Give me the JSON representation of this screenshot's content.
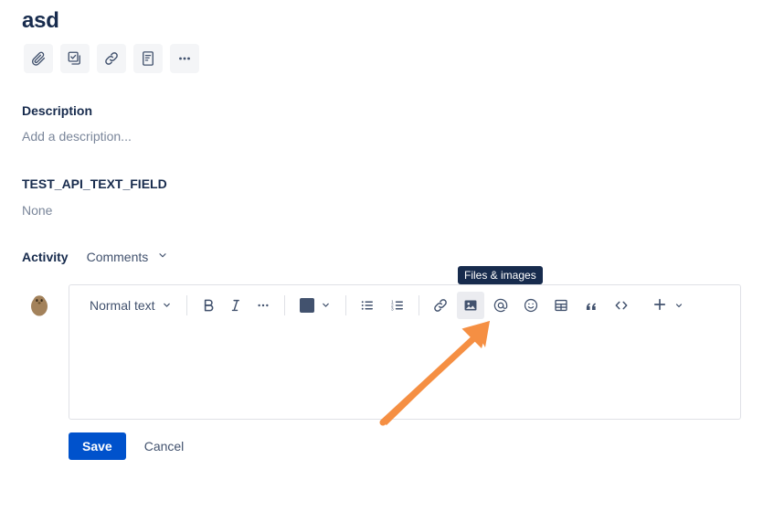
{
  "page": {
    "title": "asd"
  },
  "quick_actions": [
    {
      "name": "attach-icon",
      "label": "Attach"
    },
    {
      "name": "add-child-issue-icon",
      "label": "Add a child issue"
    },
    {
      "name": "link-issue-icon",
      "label": "Link issue"
    },
    {
      "name": "create-page-icon",
      "label": "Create Confluence page"
    },
    {
      "name": "more-actions-icon",
      "label": "More"
    }
  ],
  "fields": {
    "description": {
      "label": "Description",
      "placeholder": "Add a description..."
    },
    "custom_text": {
      "label": "TEST_API_TEXT_FIELD",
      "value": "None"
    }
  },
  "activity": {
    "title": "Activity",
    "filter_label": "Comments",
    "chevron": "chevron-down-icon"
  },
  "editor": {
    "text_style": "Normal text",
    "toolbar": [
      {
        "name": "text-style-dropdown",
        "label": "Normal text"
      },
      {
        "name": "bold-button",
        "label": "B"
      },
      {
        "name": "italic-button",
        "label": "I"
      },
      {
        "name": "more-formatting-button",
        "label": "..."
      },
      {
        "name": "text-color-button",
        "label": "Text color"
      },
      {
        "name": "bullet-list-button",
        "label": "Bullet list"
      },
      {
        "name": "numbered-list-button",
        "label": "Numbered list"
      },
      {
        "name": "link-button",
        "label": "Link"
      },
      {
        "name": "files-images-button",
        "label": "Files & images"
      },
      {
        "name": "mention-button",
        "label": "Mention"
      },
      {
        "name": "emoji-button",
        "label": "Emoji"
      },
      {
        "name": "table-button",
        "label": "Table"
      },
      {
        "name": "quote-button",
        "label": "Quote"
      },
      {
        "name": "code-snippet-button",
        "label": "Code snippet"
      },
      {
        "name": "insert-more-button",
        "label": "Insert more"
      }
    ],
    "content": "",
    "active_button": "files-images-button"
  },
  "tooltip": {
    "text": "Files & images"
  },
  "footer": {
    "save_label": "Save",
    "cancel_label": "Cancel"
  },
  "colors": {
    "primary_button": "#0052CC",
    "text_color_swatch": "#42526E",
    "tooltip_background": "#172B4D",
    "annotation_arrow": "#F58F43",
    "active_button_background": "#EBECF0"
  }
}
